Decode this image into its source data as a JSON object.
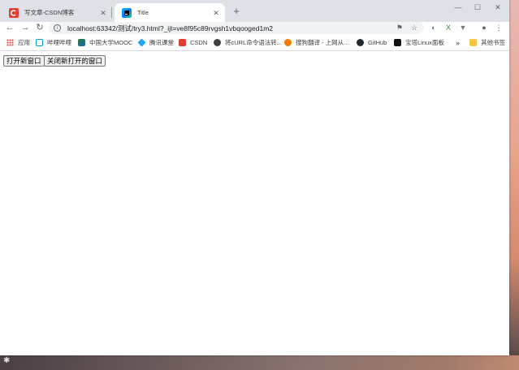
{
  "browser": {
    "tabs": [
      {
        "title": "写文章-CSDN博客",
        "favicon": "csdn-icon",
        "active": false
      },
      {
        "title": "Title",
        "favicon": "webstorm-icon",
        "active": true
      }
    ],
    "new_tab_label": "+",
    "address_bar": {
      "url": "localhost:63342/测试/try3.html?_ijt=ve8f95c89rvgsh1vbqooged1m2"
    },
    "bookmarks": [
      {
        "label": "应用",
        "icon": "apps-grid-icon",
        "color": "#4285f4"
      },
      {
        "label": "哔哩哔哩",
        "icon": "bilibili-icon",
        "color": "#00a1d6"
      },
      {
        "label": "中国大学MOOC",
        "icon": "mooc-icon",
        "color": "#2e7d32"
      },
      {
        "label": "腾讯课堂",
        "icon": "tencent-icon",
        "color": "#23a4f0"
      },
      {
        "label": "CSDN",
        "icon": "csdn-icon",
        "color": "#e33e33"
      },
      {
        "label": "将cURL命令语法转...",
        "icon": "globe-icon",
        "color": "#3c4043"
      },
      {
        "label": "搜狗翻译 - 上网从...",
        "icon": "sogou-icon",
        "color": "#f57c00"
      },
      {
        "label": "GitHub",
        "icon": "github-icon",
        "color": "#24292e"
      },
      {
        "label": "宝塔Linux面板",
        "icon": "bt-icon",
        "color": "#20a53a"
      },
      {
        "label": "»",
        "icon": "overflow-icon",
        "color": "#5f6368"
      },
      {
        "label": "其他书签",
        "icon": "folder-icon",
        "color": "#f6c344"
      }
    ]
  },
  "page": {
    "open_button": "打开新窗口",
    "close_button": "关闭新打开的窗口"
  }
}
